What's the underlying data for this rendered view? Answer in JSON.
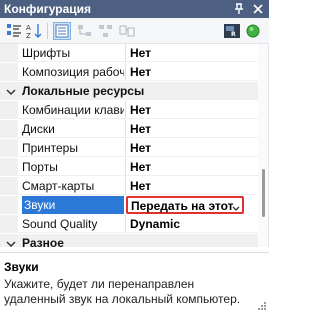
{
  "window": {
    "title": "Конфигурация"
  },
  "rows_top": [
    {
      "name": "Шрифты",
      "value": "Нет"
    },
    {
      "name": "Композиция рабочего стола",
      "value": "Нет"
    }
  ],
  "category_local": {
    "label": "Локальные ресурсы"
  },
  "rows_local": [
    {
      "name": "Комбинации клавиш",
      "value": "Нет"
    },
    {
      "name": "Диски",
      "value": "Нет"
    },
    {
      "name": "Принтеры",
      "value": "Нет"
    },
    {
      "name": "Порты",
      "value": "Нет"
    },
    {
      "name": "Смарт-карты",
      "value": "Нет"
    }
  ],
  "selected_row": {
    "name": "Звуки",
    "value": "Передать на этот компьютер"
  },
  "row_sound_quality": {
    "name": "Sound Quality",
    "value": "Dynamic"
  },
  "category_misc": {
    "label": "Разное"
  },
  "help": {
    "title": "Звуки",
    "text": "Укажите, будет ли перенаправлен удаленный звук на локальный компьютер."
  },
  "colors": {
    "titlebar": "#4d6082",
    "selection": "#2b78d6",
    "highlight_box": "#e0302f"
  }
}
